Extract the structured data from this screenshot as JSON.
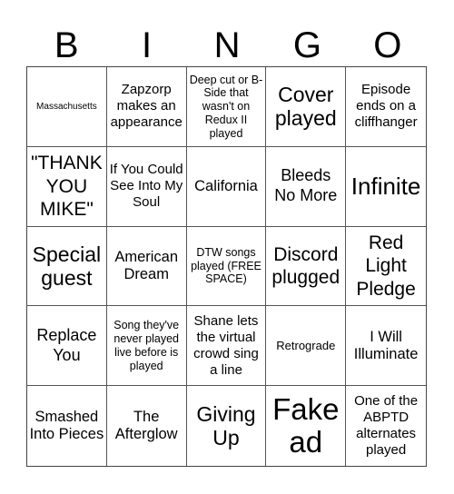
{
  "header": [
    "B",
    "I",
    "N",
    "G",
    "O"
  ],
  "cells": [
    "Massachusetts",
    "Zapzorp makes an appearance",
    "Deep cut or B-Side that wasn't on Redux II played",
    "Cover played",
    "Episode ends on a cliffhanger",
    "\"THANK YOU MIKE\"",
    "If You Could See Into My Soul",
    "California",
    "Bleeds No More",
    "Infinite",
    "Special guest",
    "American Dream",
    "DTW songs played (FREE SPACE)",
    "Discord plugged",
    "Red Light Pledge",
    "Replace You",
    "Song they've never played live before is played",
    "Shane lets the virtual crowd sing a line",
    "Retrograde",
    "I Will Illuminate",
    "Smashed Into Pieces",
    "The Afterglow",
    "Giving Up",
    "Fake ad",
    "One of the ABPTD alternates played"
  ]
}
